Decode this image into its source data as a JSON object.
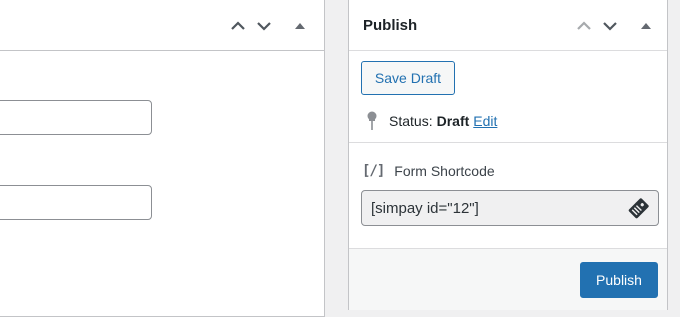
{
  "main_box": {
    "controls": {
      "move_up": "chevron-up-icon",
      "move_down": "chevron-down-icon",
      "toggle": "triangle-up-icon"
    }
  },
  "publish_box": {
    "title": "Publish",
    "controls": {
      "move_up": "chevron-up-icon",
      "move_down": "chevron-down-icon",
      "toggle": "triangle-up-icon"
    },
    "save_draft_label": "Save Draft",
    "status": {
      "label": "Status:",
      "value": "Draft",
      "edit_label": "Edit"
    },
    "shortcode": {
      "icon_text": "[/]",
      "label": "Form Shortcode",
      "value": "[simpay id=\"12\"]"
    },
    "publish_label": "Publish"
  },
  "colors": {
    "accent": "#2271b1",
    "background": "#f0f0f1",
    "border": "#c3c4c7"
  }
}
